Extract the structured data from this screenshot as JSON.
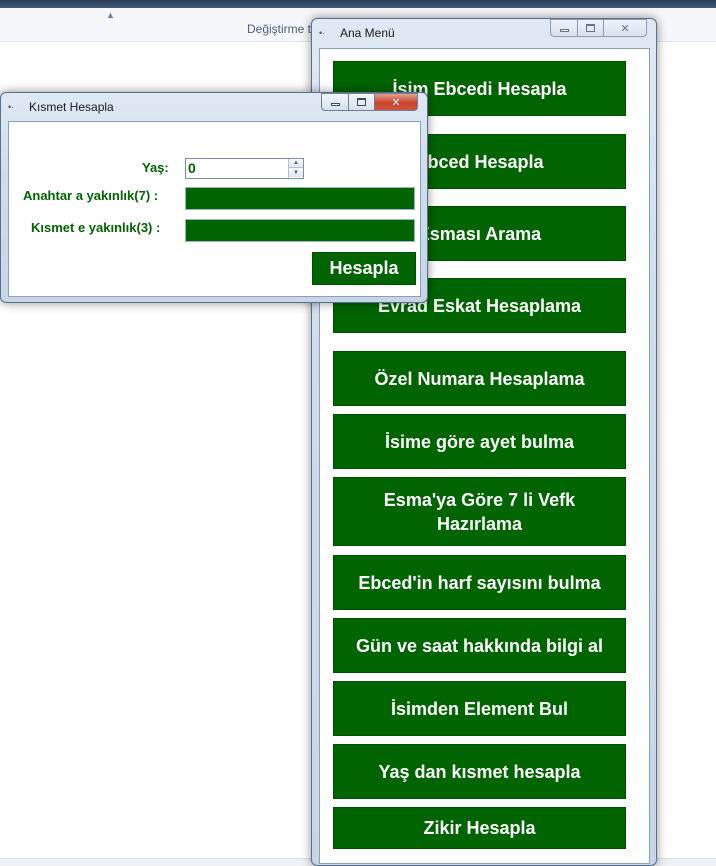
{
  "background": {
    "column_header": "Değiştirme t"
  },
  "ana_menu": {
    "title": "Ana Menü",
    "icon": "app-icon",
    "buttons": [
      "İsim Ebcedi Hesapla",
      "Ebced Hesapla",
      "Esması Arama",
      "Evrad Eskat Hesaplama",
      "Özel Numara Hesaplama",
      "İsime göre ayet bulma",
      "Esma'ya Göre 7 li Vefk Hazırlama",
      "Ebced'in harf sayısını bulma",
      "Gün ve saat hakkında bilgi al",
      "İsimden Element Bul",
      "Yaş dan kısmet hesapla",
      "Zikir Hesapla"
    ]
  },
  "kismet": {
    "title": "Kısmet Hesapla",
    "age_label": "Yaş:",
    "age_value": "0",
    "key_label": "Anahtar a yakınlık(7) :",
    "fate_label": "Kısmet e yakınlık(3) :",
    "calc_button": "Hesapla"
  },
  "colors": {
    "accent_green": "#006400",
    "title_bar": "#cfdceb",
    "close_red": "#c7422b"
  }
}
